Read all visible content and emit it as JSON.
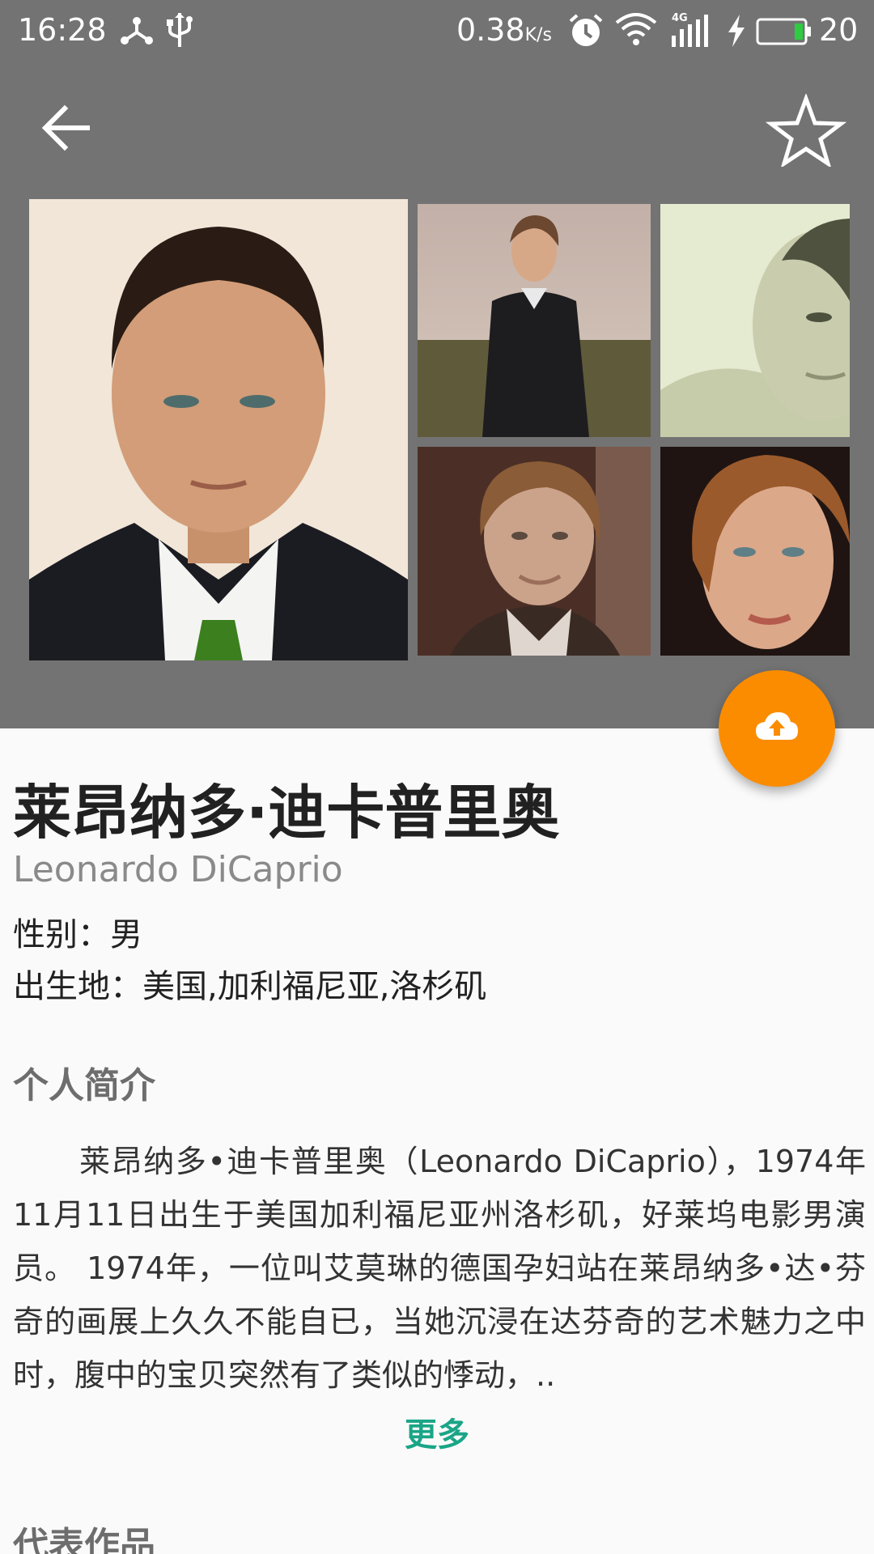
{
  "status_bar": {
    "time": "16:28",
    "speed_value": "0.38",
    "speed_unit": "K/s",
    "network_label": "4G",
    "battery_percent": "20",
    "icons": [
      "usb-debug-icon",
      "usb-icon",
      "alarm-icon",
      "wifi-icon",
      "signal-icon",
      "charging-icon",
      "battery-icon"
    ]
  },
  "toolbar": {
    "back_icon": "arrow-left-icon",
    "favorite_icon": "star-outline-icon"
  },
  "gallery": {
    "photo_count_visible": 5
  },
  "fab": {
    "icon": "cloud-upload-icon",
    "color": "#fb8c00"
  },
  "person": {
    "name_cn": "莱昂纳多·迪卡普里奥",
    "name_en": "Leonardo DiCaprio",
    "gender": "性别：男",
    "birthplace": "出生地：美国,加利福尼亚,洛杉矶"
  },
  "bio": {
    "title": "个人简介",
    "text": "莱昂纳多•迪卡普里奥（Leonardo DiCaprio），1974年11月11日出生于美国加利福尼亚州洛杉矶，好莱坞电影男演员。 1974年，一位叫艾莫琳的德国孕妇站在莱昂纳多•达•芬奇的画展上久久不能自已，当她沉浸在达芬奇的艺术魅力之中时，腹中的宝贝突然有了类似的悸动，..",
    "more_label": "更多"
  },
  "works": {
    "title": "代表作品"
  },
  "colors": {
    "header_bg": "#737373",
    "accent_link": "#1aa587",
    "fab": "#fb8c00"
  }
}
